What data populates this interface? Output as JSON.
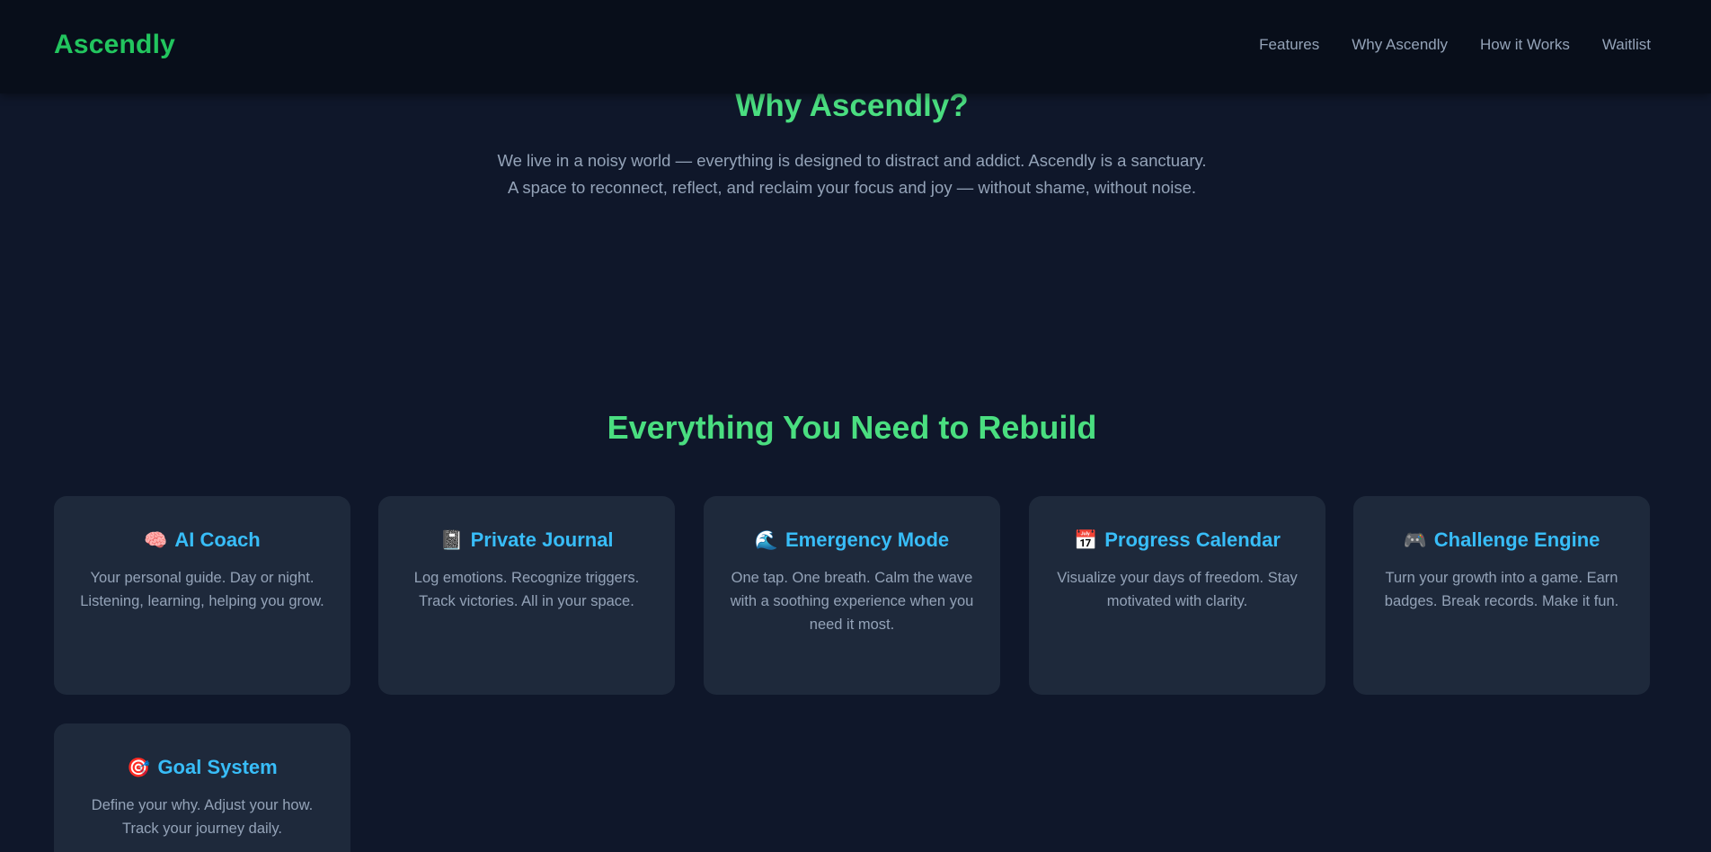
{
  "header": {
    "brand": "Ascendly",
    "nav": [
      "Features",
      "Why Ascendly",
      "How it Works",
      "Waitlist"
    ]
  },
  "why": {
    "title": "Why Ascendly?",
    "line1": "We live in a noisy world — everything is designed to distract and addict. Ascendly is a sanctuary.",
    "line2": "A space to reconnect, reflect, and reclaim your focus and joy — without shame, without noise."
  },
  "features": {
    "title": "Everything You Need to Rebuild",
    "cards": [
      {
        "icon": "🧠",
        "icon_name": "brain-icon",
        "title": "AI Coach",
        "desc": "Your personal guide. Day or night. Listening, learning, helping you grow."
      },
      {
        "icon": "📓",
        "icon_name": "notebook-icon",
        "title": "Private Journal",
        "desc": "Log emotions. Recognize triggers. Track victories. All in your space."
      },
      {
        "icon": "🌊",
        "icon_name": "wave-icon",
        "title": "Emergency Mode",
        "desc": "One tap. One breath. Calm the wave with a soothing experience when you need it most."
      },
      {
        "icon": "📅",
        "icon_name": "calendar-icon",
        "title": "Progress Calendar",
        "desc": "Visualize your days of freedom. Stay motivated with clarity."
      },
      {
        "icon": "🎮",
        "icon_name": "gamepad-icon",
        "title": "Challenge Engine",
        "desc": "Turn your growth into a game. Earn badges. Break records. Make it fun."
      },
      {
        "icon": "🎯",
        "icon_name": "target-icon",
        "title": "Goal System",
        "desc": "Define your why. Adjust your how. Track your journey daily."
      }
    ]
  },
  "colors": {
    "background": "#0f172a",
    "header": "#080e1a",
    "brand_green": "#22c55e",
    "heading_green": "#4ade80",
    "card": "#1e293b",
    "card_title_blue": "#38bdf8",
    "muted_text": "#94a3b8"
  }
}
